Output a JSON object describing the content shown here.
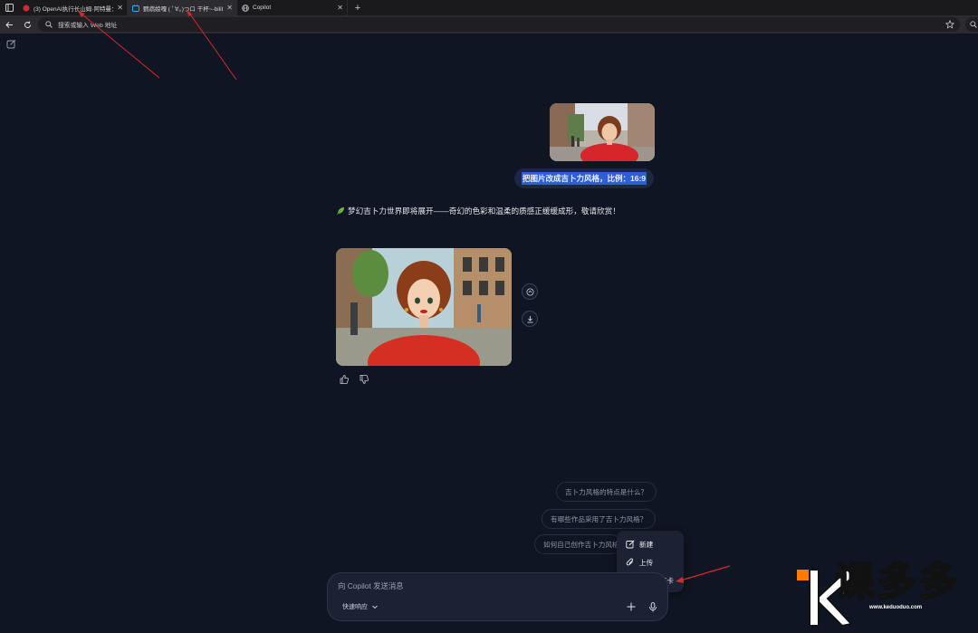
{
  "tabs": [
    {
      "title": "(3) OpenAI执行长山姆·阿特曼：A",
      "active": false,
      "icon_color": "#d72638"
    },
    {
      "title": "鹦鹉娘嘎 ( ﾟ∀。)つロ 干杯~-bilib",
      "active": true,
      "icon_color": "#23ade5"
    },
    {
      "title": "Copilot",
      "active": false,
      "icon_color": "#cfcfcf"
    }
  ],
  "address_bar": {
    "placeholder": "搜索或输入 Web 地址"
  },
  "chat": {
    "user_message": "把图片改成吉卜力风格，比例：16:9",
    "bot_message": "梦幻吉卜力世界即将展开——奇幻的色彩和温柔的质感正缓缓成形，敬请欣赏！"
  },
  "suggestions": [
    "吉卜力风格的特点是什么？",
    "有哪些作品采用了吉卜力风格？",
    "如何自己创作吉卜力风格"
  ],
  "popup_menu": {
    "items": [
      "新建",
      "上传",
      "添加选项卡"
    ]
  },
  "composer": {
    "placeholder": "向 Copilot 发送消息",
    "mode_label": "快速响应"
  },
  "watermark": {
    "brand": "课多多",
    "url": "www.keduoduo.com"
  },
  "colors": {
    "background": "#101523",
    "user_bubble": "#1d2642",
    "selection": "#2f5fd6",
    "annotation_arrow": "#d32a2a",
    "brand_orange": "#ff7a00"
  }
}
